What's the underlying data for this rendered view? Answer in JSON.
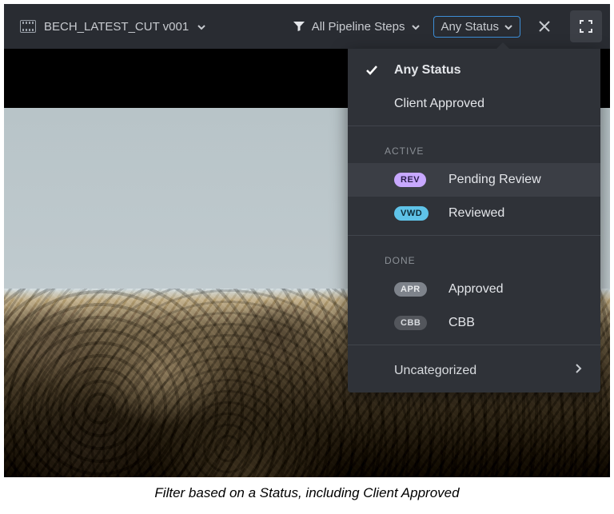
{
  "toolbar": {
    "shot_name": "BECH_LATEST_CUT v001",
    "pipeline_label": "All Pipeline Steps",
    "status_label": "Any Status"
  },
  "dropdown": {
    "any_status": "Any Status",
    "client_approved": "Client Approved",
    "section_active": "ACTIVE",
    "pending_review": {
      "tag": "REV",
      "label": "Pending Review"
    },
    "reviewed": {
      "tag": "VWD",
      "label": "Reviewed"
    },
    "section_done": "DONE",
    "approved": {
      "tag": "APR",
      "label": "Approved"
    },
    "cbb": {
      "tag": "CBB",
      "label": "CBB"
    },
    "uncategorized": "Uncategorized"
  },
  "caption": "Filter based on a Status, including Client Approved"
}
